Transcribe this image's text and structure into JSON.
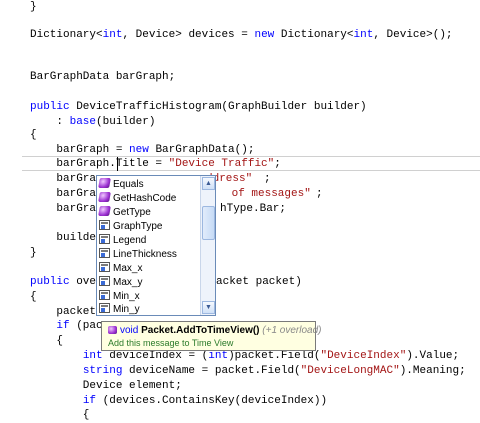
{
  "code": {
    "l1": "}",
    "l2a": "Dictionary<",
    "l2b": "int",
    "l2c": ", Device> devices = ",
    "l2d": "new",
    "l2e": " Dictionary<",
    "l2f": "int",
    "l2g": ", Device>();",
    "l3": "BarGraphData barGraph;",
    "l4a": "public",
    "l4b": " DeviceTrafficHistogram(GraphBuilder builder)",
    "l5a": "    : ",
    "l5b": "base",
    "l5c": "(builder)",
    "l6": "{",
    "l7a": "    barGraph = ",
    "l7b": "new",
    "l7c": " BarGraphData();",
    "l8a": "    barGraph.Title = ",
    "l8b": "\"Device Traffic\"",
    "l8c": ";",
    "l9a": "    barGra",
    "l9b": "ddress\"",
    "l9c": ";",
    "l10a": "    barGra",
    "l10b": " of messages\"",
    "l10c": ";",
    "l11a": "    barGra",
    "l11b": "hType.Bar;",
    "l12": "    builde",
    "l13": "}",
    "l14a": "public",
    "l14b": " ove",
    "l14c": "acket packet)",
    "l15": "{",
    "l16": "    packet",
    "l17a": "    ",
    "l17b": "if",
    "l17c": " (pac",
    "l18": "    {",
    "l19a": "        ",
    "l19b": "int",
    "l19c": " deviceIndex = (",
    "l19d": "int",
    "l19e": ")packet.Field(",
    "l19f": "\"DeviceIndex\"",
    "l19g": ").Value;",
    "l20a": "        ",
    "l20b": "string",
    "l20c": " deviceName = packet.Field(",
    "l20d": "\"DeviceLongMAC\"",
    "l20e": ").Meaning;",
    "l21": "        Device element;",
    "l22a": "        ",
    "l22b": "if",
    "l22c": " (devices.ContainsKey(deviceIndex))",
    "l23": "        {"
  },
  "completion": {
    "items": [
      {
        "label": "Equals",
        "icon": "method-icon"
      },
      {
        "label": "GetHashCode",
        "icon": "method-icon"
      },
      {
        "label": "GetType",
        "icon": "method-icon"
      },
      {
        "label": "GraphType",
        "icon": "property-icon"
      },
      {
        "label": "Legend",
        "icon": "property-icon"
      },
      {
        "label": "LineThickness",
        "icon": "property-icon"
      },
      {
        "label": "Max_x",
        "icon": "property-icon"
      },
      {
        "label": "Max_y",
        "icon": "property-icon"
      },
      {
        "label": "Min_x",
        "icon": "property-icon"
      },
      {
        "label": "Min_y",
        "icon": "property-icon"
      }
    ]
  },
  "tooltip": {
    "return_type": "void",
    "signature": "Packet.AddToTimeView()",
    "overload": "(+1 overload)",
    "description": "Add this message to Time View"
  }
}
